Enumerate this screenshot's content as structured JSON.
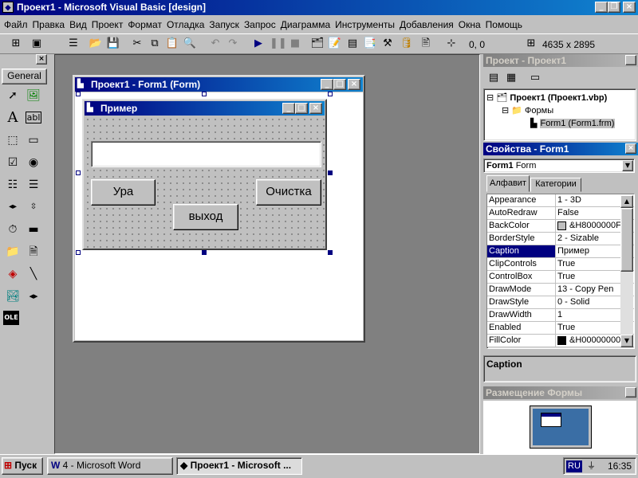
{
  "window": {
    "title": "Проект1 - Microsoft Visual Basic [design]"
  },
  "menu": [
    "Файл",
    "Правка",
    "Вид",
    "Проект",
    "Формат",
    "Отладка",
    "Запуск",
    "Запрос",
    "Диаграмма",
    "Инструменты",
    "Добавления",
    "Окна",
    "Помощь"
  ],
  "toolbar": {
    "position": "0, 0",
    "size": "4635 x 2895"
  },
  "toolbox": {
    "tab": "General"
  },
  "form_window": {
    "title": "Проект1 - Form1 (Form)"
  },
  "form": {
    "caption": "Пример",
    "textbox_value": "",
    "btn_ura": "Ура",
    "btn_clear": "Очистка",
    "btn_exit": "выход"
  },
  "project": {
    "title": "Проект - Проект1",
    "root": "Проект1 (Проект1.vbp)",
    "folder": "Формы",
    "item": "Form1 (Form1.frm)"
  },
  "properties": {
    "title": "Свойства - Form1",
    "object_name": "Form1",
    "object_type": "Form",
    "tab_alpha": "Алфавит",
    "tab_cat": "Категории",
    "rows": [
      {
        "name": "Appearance",
        "value": "1 - 3D"
      },
      {
        "name": "AutoRedraw",
        "value": "False"
      },
      {
        "name": "BackColor",
        "value": "&H8000000F",
        "swatch": "#c0c0c0"
      },
      {
        "name": "BorderStyle",
        "value": "2 - Sizable"
      },
      {
        "name": "Caption",
        "value": "Пример",
        "selected": true
      },
      {
        "name": "ClipControls",
        "value": "True"
      },
      {
        "name": "ControlBox",
        "value": "True"
      },
      {
        "name": "DrawMode",
        "value": "13 - Copy Pen"
      },
      {
        "name": "DrawStyle",
        "value": "0 - Solid"
      },
      {
        "name": "DrawWidth",
        "value": "1"
      },
      {
        "name": "Enabled",
        "value": "True"
      },
      {
        "name": "FillColor",
        "value": "&H00000000",
        "swatch": "#000000"
      }
    ],
    "desc": "Caption"
  },
  "layout_window": {
    "title": "Размещение Формы"
  },
  "taskbar": {
    "start": "Пуск",
    "task1": "4 - Microsoft Word",
    "task2": "Проект1 - Microsoft ...",
    "lang": "RU",
    "clock": "16:35"
  }
}
